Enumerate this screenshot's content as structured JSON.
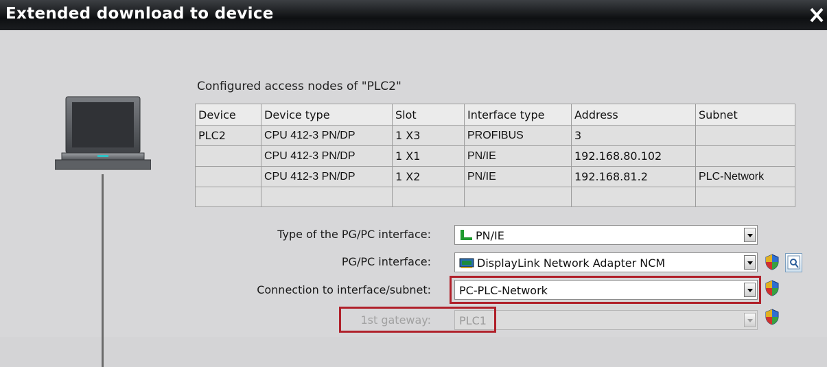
{
  "window": {
    "title": "Extended download to device",
    "close_icon": "close-icon"
  },
  "nodes": {
    "caption": "Configured access nodes of \"PLC2\"",
    "columns": [
      "Device",
      "Device type",
      "Slot",
      "Interface type",
      "Address",
      "Subnet"
    ],
    "rows": [
      [
        "PLC2",
        "CPU 412-3 PN/DP",
        "1 X3",
        "PROFIBUS",
        "3",
        ""
      ],
      [
        "",
        "CPU 412-3 PN/DP",
        "1 X1",
        "PN/IE",
        "192.168.80.102",
        ""
      ],
      [
        "",
        "CPU 412-3 PN/DP",
        "1 X2",
        "PN/IE",
        "192.168.81.2",
        "PLC-Network"
      ],
      [
        "",
        "",
        "",
        "",
        "",
        ""
      ]
    ]
  },
  "form": {
    "interface_type": {
      "label": "Type of the PG/PC interface:",
      "value": "PN/IE",
      "icon": "network-plug-icon"
    },
    "pgpc_interface": {
      "label": "PG/PC interface:",
      "value": "DisplayLink Network Adapter NCM",
      "icon": "network-card-icon"
    },
    "connection": {
      "label": "Connection to interface/subnet:",
      "value": "PC-PLC-Network"
    },
    "gateway": {
      "label": "1st gateway:",
      "value": "PLC1"
    }
  },
  "colors": {
    "highlight": "#b0202a",
    "titlebar": "#111315",
    "background": "#d7d7d9"
  }
}
